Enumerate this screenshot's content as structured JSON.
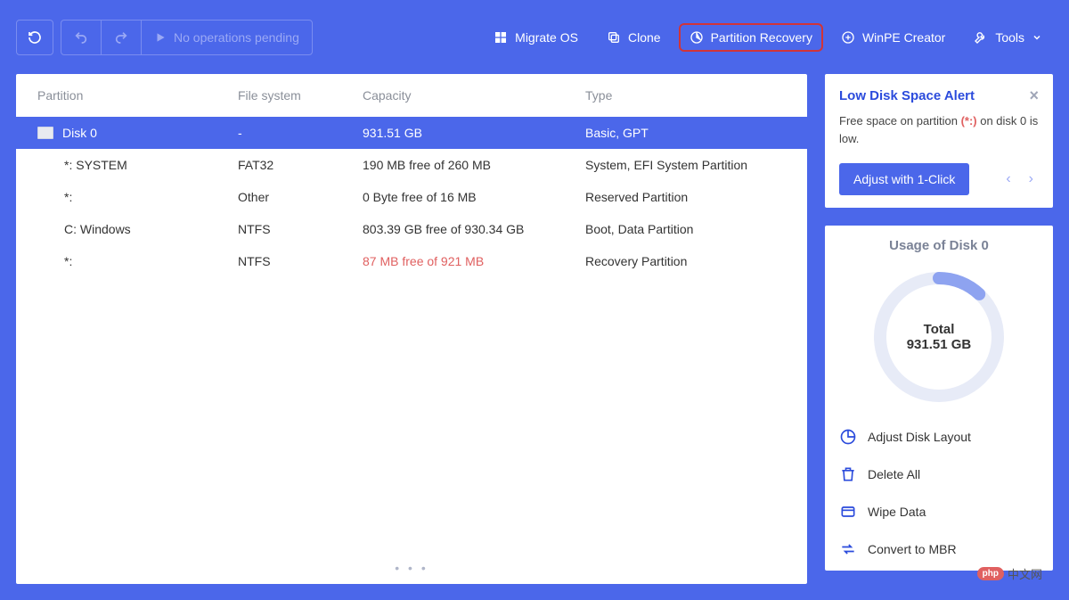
{
  "toolbar": {
    "pending_label": "No operations pending",
    "menu": {
      "migrate": "Migrate OS",
      "clone": "Clone",
      "recovery": "Partition Recovery",
      "winpe": "WinPE Creator",
      "tools": "Tools"
    }
  },
  "table": {
    "headers": {
      "partition": "Partition",
      "fs": "File system",
      "capacity": "Capacity",
      "type": "Type"
    },
    "disk": {
      "name": "Disk 0",
      "fs": "-",
      "capacity": "931.51 GB",
      "type": "Basic, GPT"
    },
    "rows": [
      {
        "name": "*: SYSTEM",
        "fs": "FAT32",
        "capacity": "190 MB free of 260 MB",
        "type": "System, EFI System Partition",
        "warn": false
      },
      {
        "name": "*:",
        "fs": "Other",
        "capacity": "0 Byte free of 16 MB",
        "type": "Reserved Partition",
        "warn": false
      },
      {
        "name": "C: Windows",
        "fs": "NTFS",
        "capacity": "803.39 GB free of 930.34 GB",
        "type": "Boot, Data Partition",
        "warn": false
      },
      {
        "name": "*:",
        "fs": "NTFS",
        "capacity": "87 MB free of 921 MB",
        "type": "Recovery Partition",
        "warn": true
      }
    ]
  },
  "alert": {
    "title": "Low Disk Space Alert",
    "text_before": "Free space on partition ",
    "hot": "(*:)",
    "text_after": " on disk 0 is low.",
    "button": "Adjust with 1-Click"
  },
  "usage": {
    "title": "Usage of Disk 0",
    "label": "Total",
    "value": "931.51 GB",
    "percent": 12
  },
  "actions": {
    "adjust": "Adjust Disk Layout",
    "delete": "Delete All",
    "wipe": "Wipe Data",
    "convert": "Convert to MBR"
  },
  "watermark": "中文网",
  "chart_data": {
    "type": "pie",
    "title": "Usage of Disk 0",
    "series": [
      {
        "name": "Used",
        "value": 12,
        "unit": "%"
      },
      {
        "name": "Free",
        "value": 88,
        "unit": "%"
      }
    ],
    "center_label": "Total",
    "center_value": "931.51 GB"
  }
}
